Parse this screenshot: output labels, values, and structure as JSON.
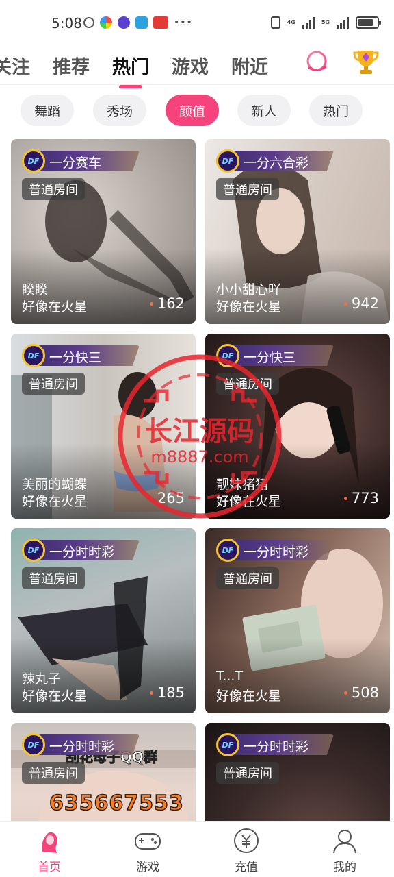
{
  "status_bar": {
    "time": "5:08",
    "network_labels": [
      "4G",
      "5G"
    ],
    "icons": [
      "bolt-icon",
      "color-wheel-icon",
      "infinity-icon",
      "telegram-icon",
      "app-badge-icon",
      "more-dots-icon",
      "vibrate-icon",
      "signal-icon",
      "battery-icon"
    ]
  },
  "top_tabs": [
    {
      "label": "关注"
    },
    {
      "label": "推荐"
    },
    {
      "label": "热门",
      "active": true
    },
    {
      "label": "游戏"
    },
    {
      "label": "附近"
    }
  ],
  "top_actions": {
    "search_icon": "search-icon",
    "ranking_icon": "trophy-icon"
  },
  "categories": [
    {
      "label": "舞蹈"
    },
    {
      "label": "秀场"
    },
    {
      "label": "颜值",
      "active": true
    },
    {
      "label": "新人"
    },
    {
      "label": "热门"
    }
  ],
  "room_badge_text": "普通房间",
  "game_logo_text": "DF",
  "rooms": [
    {
      "game": "一分赛车",
      "name": "睽睽",
      "location": "好像在火星",
      "viewers": "162"
    },
    {
      "game": "一分六合彩",
      "name": "小小甜心吖",
      "location": "好像在火星",
      "viewers": "942"
    },
    {
      "game": "一分快三",
      "name": "美丽的蝴蝶",
      "location": "好像在火星",
      "viewers": "265"
    },
    {
      "game": "一分快三",
      "name": "靓妹猪猪",
      "location": "好像在火星",
      "viewers": "773"
    },
    {
      "game": "一分时时彩",
      "name": "辣丸子",
      "location": "好像在火星",
      "viewers": "185"
    },
    {
      "game": "一分时时彩",
      "name": "T...T",
      "location": "好像在火星",
      "viewers": "508"
    },
    {
      "game": "一分时时彩",
      "overlay_banner": "刮花母子QQ群",
      "overlay_number": "635667553"
    },
    {
      "game": "一分时时彩"
    }
  ],
  "watermark": {
    "title": "长江源码",
    "url": "m8887.com"
  },
  "bottom_nav": [
    {
      "label": "首页",
      "icon": "home-avatar-icon",
      "active": true
    },
    {
      "label": "游戏",
      "icon": "gamepad-icon"
    },
    {
      "label": "充值",
      "icon": "yuan-coin-icon"
    },
    {
      "label": "我的",
      "icon": "user-icon"
    }
  ],
  "colors": {
    "accent": "#f5437c",
    "pill_bg": "#f1f1f4",
    "tag_purple": "#3a2a6a",
    "logo_gold": "#f3c530",
    "viewer_dot": "#ff6b3d",
    "watermark_red": "#e8262f"
  }
}
